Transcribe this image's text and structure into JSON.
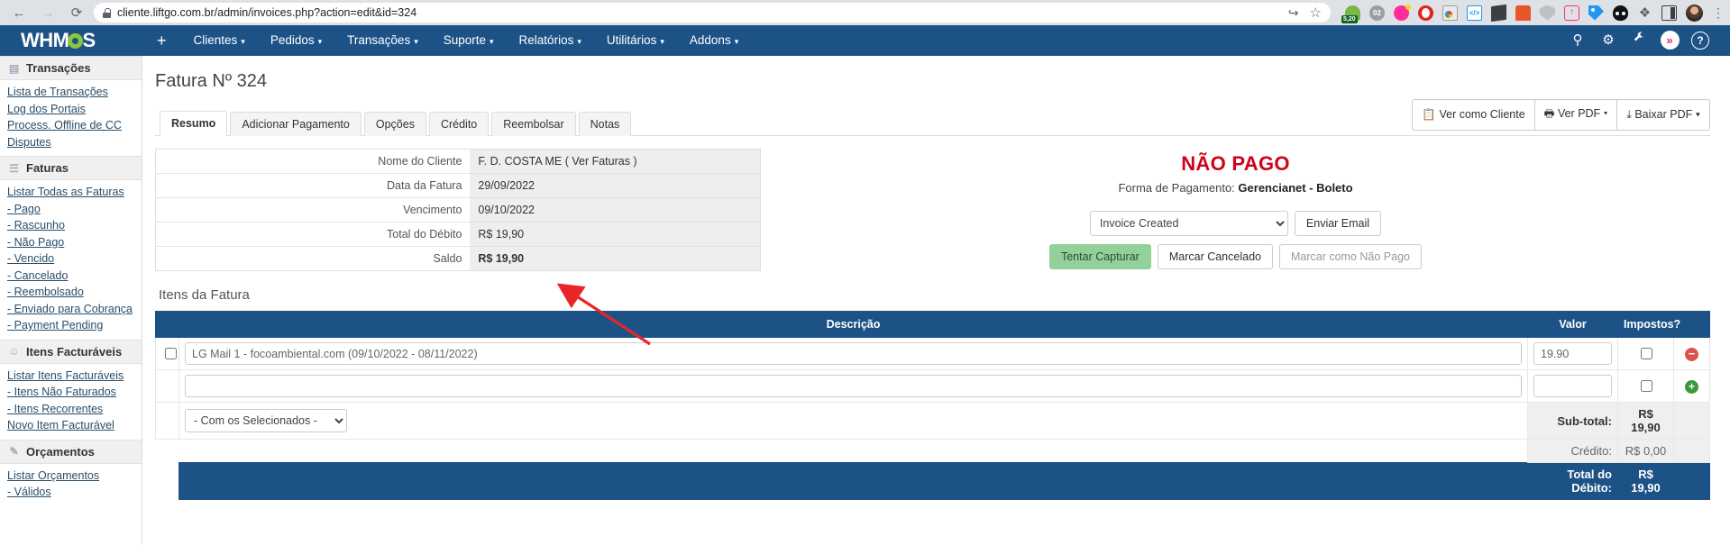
{
  "browser": {
    "back_icon": "back-arrow-icon",
    "forward_icon": "forward-arrow-icon",
    "reload_icon": "reload-icon",
    "url": "cliente.liftgo.com.br/admin/invoices.php?action=edit&id=324",
    "share_glyph": "↪",
    "star_glyph": "☆",
    "badge_value": "5,20",
    "gray_ext_label": "02",
    "code_ext_label": "</>",
    "upload_glyph": "↑",
    "puzzle_glyph": "❖",
    "kebab_glyph": "⋮"
  },
  "topnav": {
    "brand_left": "WHM",
    "brand_right": "S",
    "plus_label": "+",
    "items": [
      {
        "label": "Clientes"
      },
      {
        "label": "Pedidos"
      },
      {
        "label": "Transações"
      },
      {
        "label": "Suporte"
      },
      {
        "label": "Relatórios"
      },
      {
        "label": "Utilitários"
      },
      {
        "label": "Addons"
      }
    ],
    "caret": "▾",
    "search_glyph": "⚲",
    "gears_glyph": "⚙",
    "wrench_glyph": "🔧",
    "chevron_glyph": "»",
    "help_glyph": "?"
  },
  "sidebar": {
    "sections": [
      {
        "title": "Transações",
        "icon": "credit-card-icon",
        "icon_glyph": "▤",
        "links": [
          "Lista de Transações",
          "Log dos Portais",
          "Process. Offline de CC",
          "Disputes"
        ]
      },
      {
        "title": "Faturas",
        "icon": "invoice-document-icon",
        "icon_glyph": "☰",
        "links": [
          "Listar Todas as Faturas",
          "- Pago",
          "- Rascunho",
          "- Não Pago",
          "- Vencido",
          "- Cancelado",
          "- Reembolsado",
          "- Enviado para Cobrança",
          "- Payment Pending"
        ]
      },
      {
        "title": "Itens Facturáveis",
        "title_display": "Itens Facturáveis",
        "icon": "user-plus-icon",
        "icon_glyph": "☺",
        "links": [
          "Listar Itens Facturáveis",
          "- Itens Não Faturados",
          "- Itens Recorrentes",
          "Novo Item Facturável"
        ]
      },
      {
        "title": "Orçamentos",
        "icon": "quote-edit-icon",
        "icon_glyph": "✎",
        "links": [
          "Listar Orçamentos",
          "- Válidos"
        ]
      }
    ]
  },
  "page": {
    "title": "Fatura Nº 324",
    "items_title": "Itens da Fatura"
  },
  "toolbar": {
    "view_as_client": "Ver como Cliente",
    "view_as_client_icon": "clipboard-icon",
    "view_pdf": "Ver PDF",
    "view_pdf_icon": "printer-icon",
    "download_pdf": "Baixar PDF",
    "download_pdf_icon": "download-icon",
    "caret": "▾"
  },
  "tabs": [
    {
      "label": "Resumo",
      "active": true
    },
    {
      "label": "Adicionar Pagamento",
      "active": false
    },
    {
      "label": "Opções",
      "active": false
    },
    {
      "label": "Crédito",
      "active": false
    },
    {
      "label": "Reembolsar",
      "active": false
    },
    {
      "label": "Notas",
      "active": false
    }
  ],
  "summary": {
    "rows": [
      {
        "label": "Nome do Cliente",
        "value": "F. D. COSTA ME ( Ver Faturas )",
        "style": "normal"
      },
      {
        "label": "Data da Fatura",
        "value": "29/09/2022",
        "style": "normal"
      },
      {
        "label": "Vencimento",
        "value": "09/10/2022",
        "style": "normal"
      },
      {
        "label": "Total do Débito",
        "value": "R$ 19,90",
        "style": "normal"
      },
      {
        "label": "Saldo",
        "value": "R$ 19,90",
        "style": "red-bold"
      }
    ]
  },
  "status": {
    "title": "NÃO PAGO",
    "payment_label": "Forma de Pagamento:",
    "payment_value": "Gerencianet - Boleto",
    "email_select_value": "Invoice Created",
    "send_email_button": "Enviar Email",
    "capture_button": "Tentar Capturar",
    "cancel_button": "Marcar Cancelado",
    "unpaid_button": "Marcar como Não Pago"
  },
  "items_table": {
    "headers": [
      "",
      "Descrição",
      "Valor",
      "Impostos?",
      ""
    ],
    "rows": [
      {
        "description": "LG Mail 1 - focoambiental.com (09/10/2022 - 08/11/2022)",
        "amount": "19.90",
        "taxed": false,
        "action": "remove"
      },
      {
        "description": "",
        "amount": "",
        "taxed": false,
        "action": "add"
      }
    ],
    "bulk_action": "- Com os Selecionados -",
    "totals": [
      {
        "label": "Sub-total:",
        "value": "R$ 19,90",
        "emphasis": "strong"
      },
      {
        "label": "Crédito:",
        "value": "R$ 0,00",
        "emphasis": "soft"
      },
      {
        "label": "Total do Débito:",
        "value": "R$ 19,90",
        "emphasis": "grand"
      }
    ],
    "remove_glyph": "−",
    "add_glyph": "+"
  },
  "colors": {
    "brand_blue": "#1d5287",
    "status_red": "#d0021b",
    "accent_green": "#8cc63f",
    "annotation_red": "#e8262a"
  }
}
